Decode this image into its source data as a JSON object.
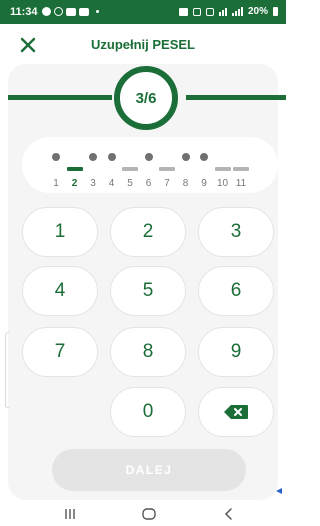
{
  "status_bar": {
    "time": "11:34",
    "battery": "20%",
    "background_color": "#1b6e38",
    "left_icons": [
      "facebook-icon",
      "instagram-icon",
      "youtube-icon",
      "youtube-icon",
      "notification-dot-icon"
    ],
    "right_icons": [
      "sim-icon",
      "alarm-icon",
      "mute-icon",
      "wifi-icon",
      "signal-icon",
      "battery-icon"
    ]
  },
  "header": {
    "title": "Uzupełnij PESEL",
    "close_icon": "close-icon"
  },
  "progress": {
    "label": "3/6",
    "current_step": 3,
    "total_steps": 6,
    "accent_color": "#1b6e38"
  },
  "pesel_indicator": {
    "positions": [
      {
        "number": "1",
        "entered": true,
        "active": false
      },
      {
        "number": "2",
        "entered": false,
        "active": true
      },
      {
        "number": "3",
        "entered": true,
        "active": false
      },
      {
        "number": "4",
        "entered": true,
        "active": false
      },
      {
        "number": "5",
        "entered": false,
        "active": false
      },
      {
        "number": "6",
        "entered": true,
        "active": false
      },
      {
        "number": "7",
        "entered": false,
        "active": false
      },
      {
        "number": "8",
        "entered": true,
        "active": false
      },
      {
        "number": "9",
        "entered": true,
        "active": false
      },
      {
        "number": "10",
        "entered": false,
        "active": false
      },
      {
        "number": "11",
        "entered": false,
        "active": false
      }
    ]
  },
  "keypad": {
    "keys": [
      "1",
      "2",
      "3",
      "4",
      "5",
      "6",
      "7",
      "8",
      "9",
      "0"
    ],
    "backspace_icon": "backspace-icon"
  },
  "next_button": {
    "label": "DALEJ",
    "enabled": false
  },
  "nav_bar": {
    "icons": [
      "recent-apps-icon",
      "home-icon",
      "back-icon"
    ]
  }
}
